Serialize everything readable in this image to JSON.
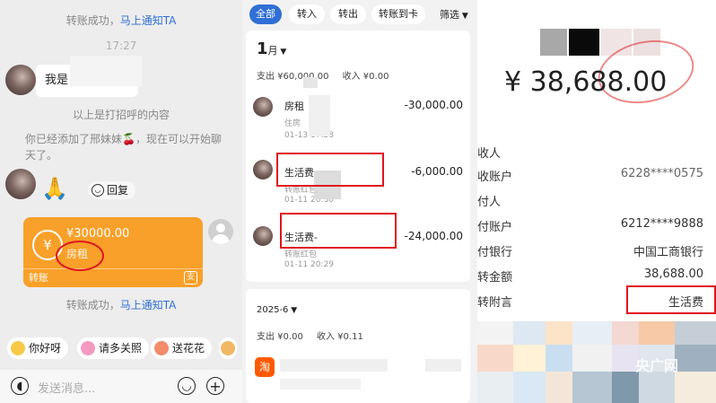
{
  "chat": {
    "transfer_success_top": "转账成功，",
    "notify_link": "马上通知TA",
    "time": "17:27",
    "greeting_prefix": "我是",
    "greeting_note": "以上是打招呼的内容",
    "added_msg": "你已经添加了邢妹妹🍒，现在可以开始聊天了。",
    "reply_label": "回复",
    "transfer_card": {
      "amount": "¥30000.00",
      "memo": "房租",
      "footer": "转账"
    },
    "transfer_success_bottom": "转账成功，",
    "notify_link_bottom": "马上通知TA",
    "quick_replies": [
      "你好呀",
      "请多关照",
      "送花花"
    ],
    "input_placeholder": "发送消息..."
  },
  "bills": {
    "filters": [
      "全部",
      "转入",
      "转出",
      "转账到卡"
    ],
    "filter_more": "筛选",
    "month": "1",
    "month_unit": "月",
    "expense_summary": "支出 ¥60,000.00",
    "income_summary": "收入 ¥0.00",
    "items": [
      {
        "title": "房租",
        "sub1": "住房",
        "date": "01-13 17:28",
        "amount": "-30,000.00"
      },
      {
        "title": "生活费",
        "sub1": "转账红包",
        "date": "01-11 20:30",
        "amount": "-6,000.00"
      },
      {
        "title": "生活费-",
        "sub1": "转账红包",
        "date": "01-11 20:29",
        "amount": "-24,000.00"
      }
    ],
    "period2": "2025-6",
    "expense2": "支出 ¥0.00",
    "income2": "收入 ¥0.11",
    "taobao_icon": "淘"
  },
  "receipt": {
    "amount": "¥ 38,688.00",
    "rows": [
      {
        "label": "收人",
        "value": ""
      },
      {
        "label": "收账户",
        "value": "6228****0575"
      },
      {
        "label": "付人",
        "value": ""
      },
      {
        "label": "付账户",
        "value": "6212****9888"
      },
      {
        "label": "付银行",
        "value": "中国工商银行"
      },
      {
        "label": "转金额",
        "value": "38,688.00"
      },
      {
        "label": "转附言",
        "value": "生活费"
      }
    ],
    "watermark": "央广网",
    "colors": {
      "accent_red": "#e0141e",
      "transfer_orange": "#f8a029",
      "link_blue": "#2f6fd6",
      "chip_blue": "#2f6fd6"
    }
  }
}
